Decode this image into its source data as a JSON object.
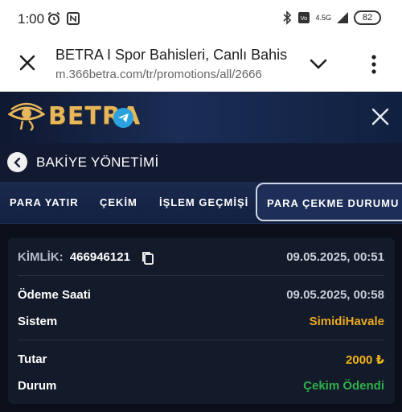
{
  "status_bar": {
    "time": "1:00",
    "network": "4.5G",
    "battery": "82"
  },
  "browser": {
    "page_title": "BETRA I Spor Bahisleri, Canlı Bahis",
    "url": "m.366betra.com/tr/promotions/all/2666"
  },
  "app": {
    "brand": "BETRA"
  },
  "section": {
    "title": "BAKİYE YÖNETİMİ"
  },
  "tabs": [
    {
      "label": "PARA YATIR"
    },
    {
      "label": "ÇEKİM"
    },
    {
      "label": "İŞLEM GEÇMİŞİ"
    },
    {
      "label": "PARA ÇEKME DURUMU"
    }
  ],
  "transaction": {
    "id_label": "KİMLİK:",
    "id_value": "466946121",
    "created": "09.05.2025, 00:51",
    "payment_time_label": "Ödeme Saati",
    "payment_time": "09.05.2025, 00:58",
    "system_label": "Sistem",
    "system": "SimidiHavale",
    "amount_label": "Tutar",
    "amount": "2000 ₺",
    "status_label": "Durum",
    "status": "Çekim Ödendi"
  },
  "colors": {
    "accent_gold": "#e9a81f",
    "status_green": "#2fb14a",
    "brand_gold": "#e7b659"
  }
}
